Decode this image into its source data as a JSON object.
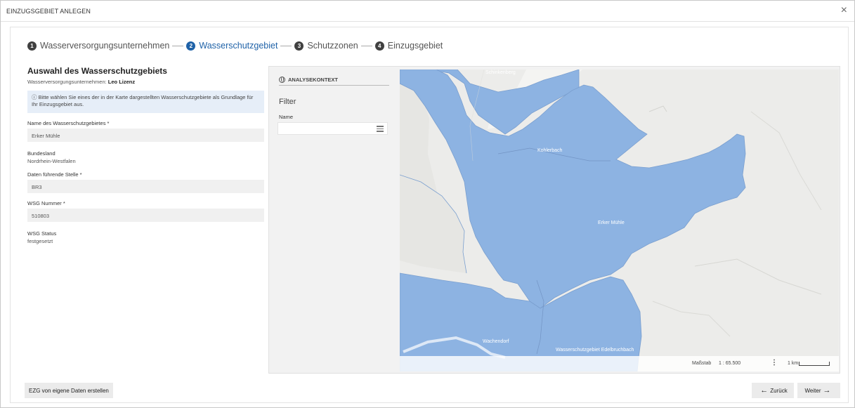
{
  "dialog": {
    "title": "EINZUGSGEBIET ANLEGEN",
    "close_icon": "×"
  },
  "stepper": [
    {
      "num": "1",
      "label": "Wasserversorgungsunternehmen",
      "active": false
    },
    {
      "num": "2",
      "label": "Wasserschutzgebiet",
      "active": true
    },
    {
      "num": "3",
      "label": "Schutzzonen",
      "active": false
    },
    {
      "num": "4",
      "label": "Einzugsgebiet",
      "active": false
    }
  ],
  "left": {
    "title": "Auswahl des Wasserschutzgebiets",
    "subtitle_prefix": "Wasserversorgungsunternehmen:",
    "subtitle_value": "Leo Lizenz",
    "info_icon": "ⓘ",
    "info_text": "Bitte wählen Sie eines der in der Karte dargestellten Wasserschutzgebiete als Grundlage für Ihr Einzugsgebiet aus.",
    "name_label": "Name des Wasserschutzgebietes *",
    "name_value": "Erker Mühle",
    "bundesland_label": "Bundesland",
    "bundesland_value": "Nordrhein-Westfalen",
    "stelle_label": "Daten führende Stelle *",
    "stelle_value": "BR3",
    "nummer_label": "WSG Nummer *",
    "nummer_value": "510803",
    "status_label": "WSG Status",
    "status_value": "festgesetzt"
  },
  "panel": {
    "context_label": "ANALYSEKONTEXT",
    "filter_title": "Filter",
    "name_label": "Name",
    "map_labels": {
      "top": "Schinkenberg",
      "north": "Kohlerbach",
      "center": "Erker Mühle",
      "southwest": "Wachendorf",
      "south": "Wasserschutzgebiet Edelbruchbach"
    },
    "scale_label": "Maßstab",
    "scale_value": "1 : 65.500",
    "scale_menu": "⋮",
    "scale_distance": "1 km"
  },
  "footer": {
    "create_label": "EZG von eigene Daten erstellen",
    "back_label": "Zurück",
    "next_label": "Weiter",
    "back_arrow": "←",
    "next_arrow": "→"
  },
  "colors": {
    "accent": "#1f62a8",
    "area_fill": "#8db3e2",
    "map_bg": "#ececea"
  }
}
